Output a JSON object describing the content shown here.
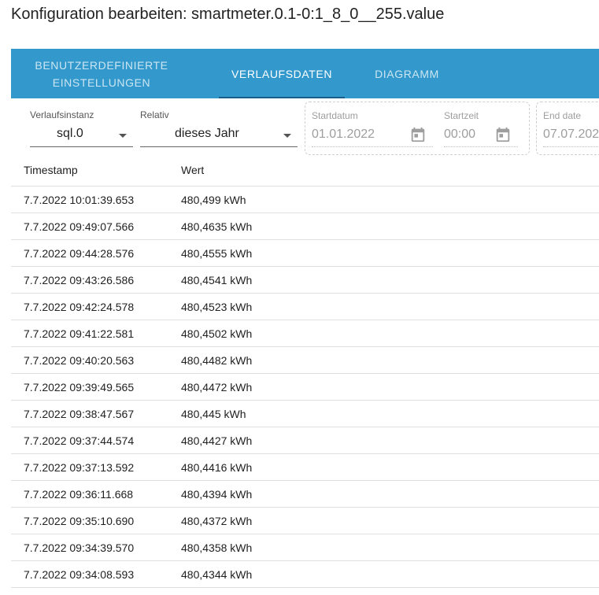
{
  "title": "Konfiguration bearbeiten: smartmeter.0.1-0:1_8_0__255.value",
  "tabs": [
    {
      "label": "Benutzerdefinierte Einstellungen",
      "active": false
    },
    {
      "label": "Verlaufsdaten",
      "active": true
    },
    {
      "label": "Diagramm",
      "active": false
    }
  ],
  "controls": {
    "instance": {
      "label": "Verlaufsinstanz",
      "value": "sql.0"
    },
    "relative": {
      "label": "Relativ",
      "value": "dieses Jahr"
    },
    "start_date": {
      "label": "Startdatum",
      "value": "01.01.2022"
    },
    "start_time": {
      "label": "Startzeit",
      "value": "00:00"
    },
    "end_date": {
      "label": "End date",
      "value": "07.07.2022"
    }
  },
  "table": {
    "headers": [
      "Timestamp",
      "Wert"
    ],
    "rows": [
      [
        "7.7.2022 10:01:39.653",
        "480,499 kWh"
      ],
      [
        "7.7.2022 09:49:07.566",
        "480,4635 kWh"
      ],
      [
        "7.7.2022 09:44:28.576",
        "480,4555 kWh"
      ],
      [
        "7.7.2022 09:43:26.586",
        "480,4541 kWh"
      ],
      [
        "7.7.2022 09:42:24.578",
        "480,4523 kWh"
      ],
      [
        "7.7.2022 09:41:22.581",
        "480,4502 kWh"
      ],
      [
        "7.7.2022 09:40:20.563",
        "480,4482 kWh"
      ],
      [
        "7.7.2022 09:39:49.565",
        "480,4472 kWh"
      ],
      [
        "7.7.2022 09:38:47.567",
        "480,445 kWh"
      ],
      [
        "7.7.2022 09:37:44.574",
        "480,4427 kWh"
      ],
      [
        "7.7.2022 09:37:13.592",
        "480,4416 kWh"
      ],
      [
        "7.7.2022 09:36:11.668",
        "480,4394 kWh"
      ],
      [
        "7.7.2022 09:35:10.690",
        "480,4372 kWh"
      ],
      [
        "7.7.2022 09:34:39.570",
        "480,4358 kWh"
      ],
      [
        "7.7.2022 09:34:08.593",
        "480,4344 kWh"
      ]
    ]
  },
  "colors": {
    "tabbar": "#3399cc",
    "active_indicator": "#1a5f8a"
  },
  "icons": {
    "date": "calendar-icon",
    "time": "calendar-icon",
    "dropdown": "chevron-down-icon"
  }
}
